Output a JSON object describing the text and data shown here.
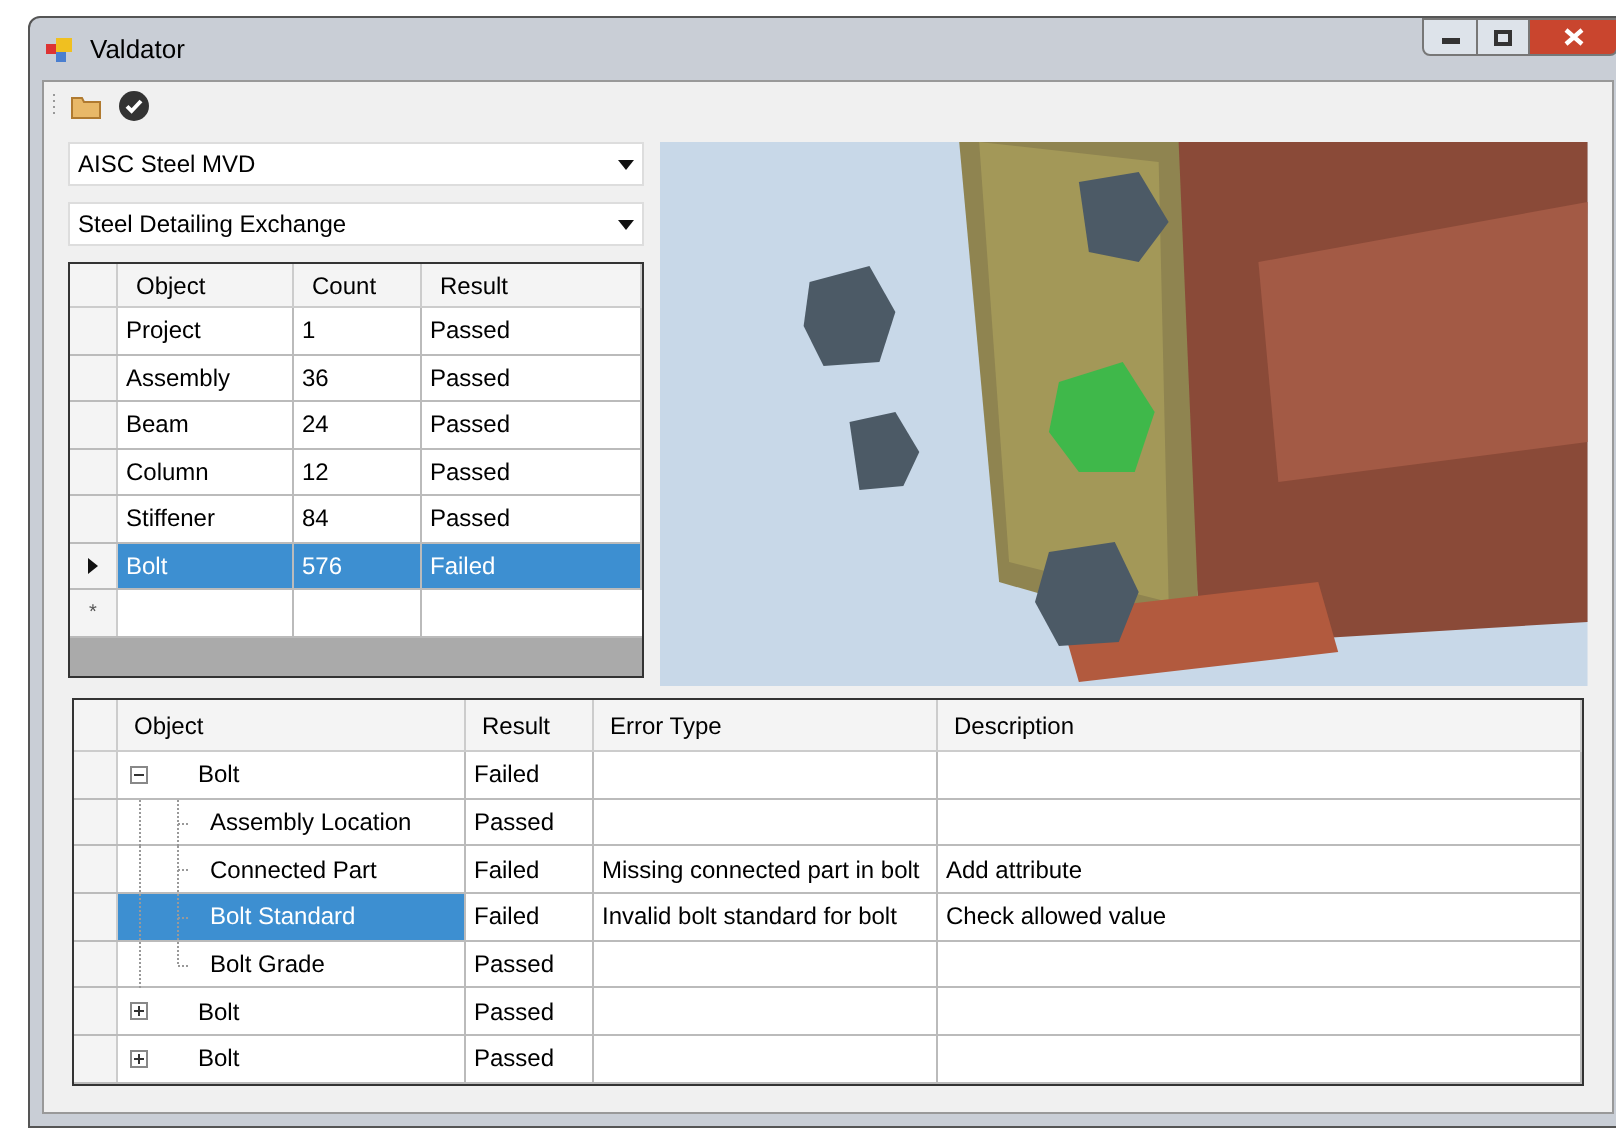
{
  "window": {
    "title": "Valdator"
  },
  "combos": [
    {
      "value": "AISC Steel MVD"
    },
    {
      "value": "Steel Detailing Exchange"
    }
  ],
  "summary": {
    "columns": [
      "Object",
      "Count",
      "Result"
    ],
    "rows": [
      {
        "object": "Project",
        "count": "1",
        "result": "Passed",
        "selected": false
      },
      {
        "object": "Assembly",
        "count": "36",
        "result": "Passed",
        "selected": false
      },
      {
        "object": "Beam",
        "count": "24",
        "result": "Passed",
        "selected": false
      },
      {
        "object": "Column",
        "count": "12",
        "result": "Passed",
        "selected": false
      },
      {
        "object": "Stiffener",
        "count": "84",
        "result": "Passed",
        "selected": false
      },
      {
        "object": "Bolt",
        "count": "576",
        "result": "Failed",
        "selected": true
      }
    ],
    "new_row_marker": "*"
  },
  "details": {
    "columns": [
      "Object",
      "Result",
      "Error Type",
      "Description"
    ],
    "rows": [
      {
        "object": "Bolt",
        "result": "Failed",
        "expanded": true,
        "selected": false,
        "children": [
          {
            "object": "Assembly Location",
            "result": "Passed",
            "selected": false
          },
          {
            "object": "Connected Part",
            "result": "Failed",
            "error_type": "Missing connected part in bolt",
            "description": "Add attribute",
            "selected": false
          },
          {
            "object": "Bolt Standard",
            "result": "Failed",
            "error_type": "Invalid bolt standard for bolt",
            "description": "Check allowed value",
            "selected": true
          },
          {
            "object": "Bolt Grade",
            "result": "Passed",
            "selected": false
          }
        ]
      },
      {
        "object": "Bolt",
        "result": "Passed",
        "expanded": false,
        "selected": false
      },
      {
        "object": "Bolt",
        "result": "Passed",
        "expanded": false,
        "selected": false
      }
    ]
  }
}
